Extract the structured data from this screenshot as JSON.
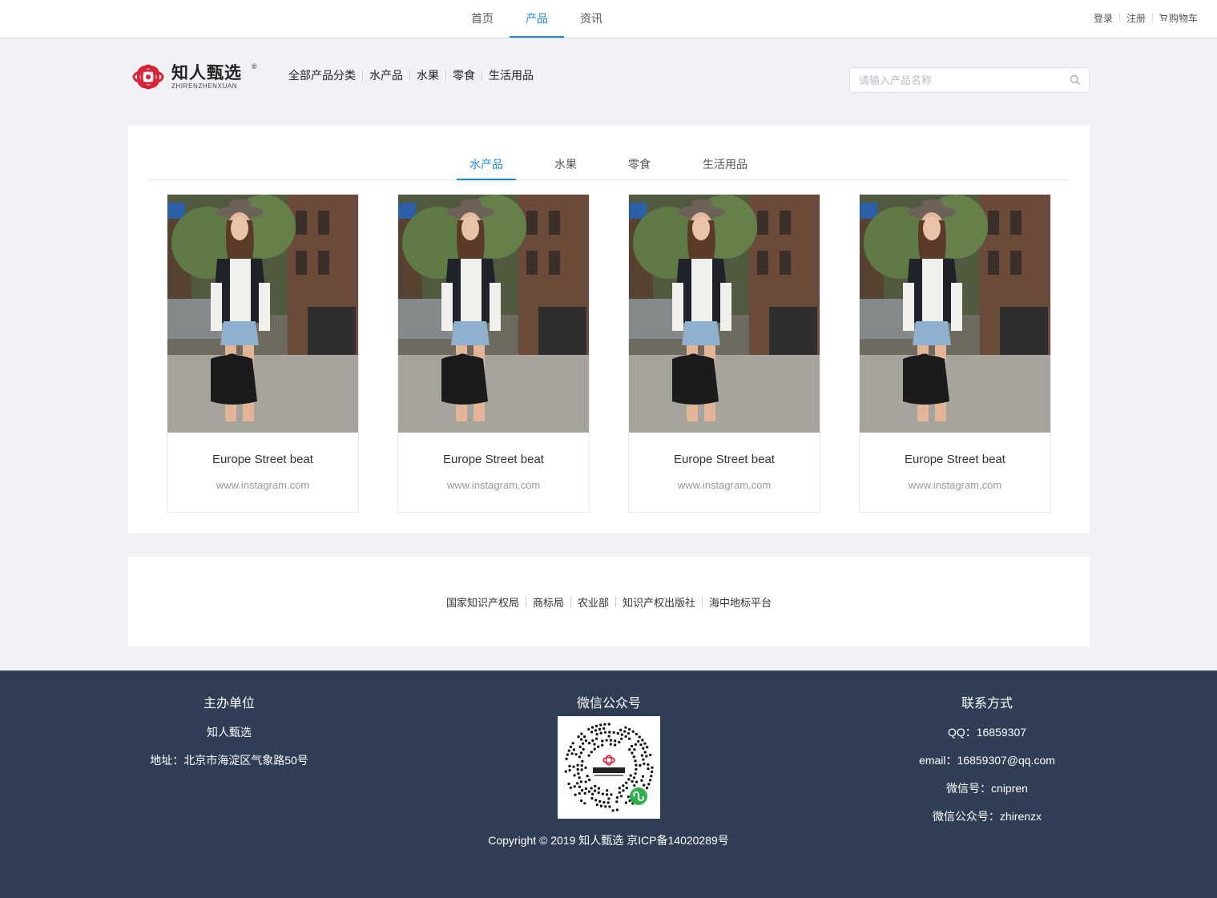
{
  "topnav": {
    "items": [
      "首页",
      "产品",
      "资讯"
    ],
    "active_index": 1
  },
  "toplinks": {
    "login": "登录",
    "register": "注册",
    "cart": "购物车"
  },
  "logo": {
    "cn": "知人甄选",
    "en": "ZHIRENZHENXUAN",
    "reg": "®"
  },
  "catnav": [
    "全部产品分类",
    "水产品",
    "水果",
    "零食",
    "生活用品"
  ],
  "search": {
    "placeholder": "请输入产品名称",
    "value": ""
  },
  "tabs": {
    "items": [
      "水产品",
      "水果",
      "零食",
      "生活用品"
    ],
    "active_index": 0
  },
  "products": [
    {
      "title": "Europe Street beat",
      "subtitle": "www.instagram.com"
    },
    {
      "title": "Europe Street beat",
      "subtitle": "www.instagram.com"
    },
    {
      "title": "Europe Street beat",
      "subtitle": "www.instagram.com"
    },
    {
      "title": "Europe Street beat",
      "subtitle": "www.instagram.com"
    }
  ],
  "friend_links": [
    "国家知识产权局",
    "商标局",
    "农业部",
    "知识产权出版社",
    "海中地标平台"
  ],
  "footer": {
    "host": {
      "heading": "主办单位",
      "name": "知人甄选",
      "address": "地址：北京市海淀区气象路50号"
    },
    "wechat": {
      "heading": "微信公众号"
    },
    "contact": {
      "heading": "联系方式",
      "qq": "QQ：16859307",
      "email": "email：16859307@qq.com",
      "wechat_id": "微信号：cnipren",
      "official": "微信公众号：zhirenzx"
    },
    "copyright": "Copyright © 2019 知人甄选 京ICP备14020289号"
  },
  "colors": {
    "accent": "#1e88e5",
    "footer_bg": "#2f3e55",
    "page_bg": "#f0f2f5",
    "logo_red": "#d4243a"
  }
}
